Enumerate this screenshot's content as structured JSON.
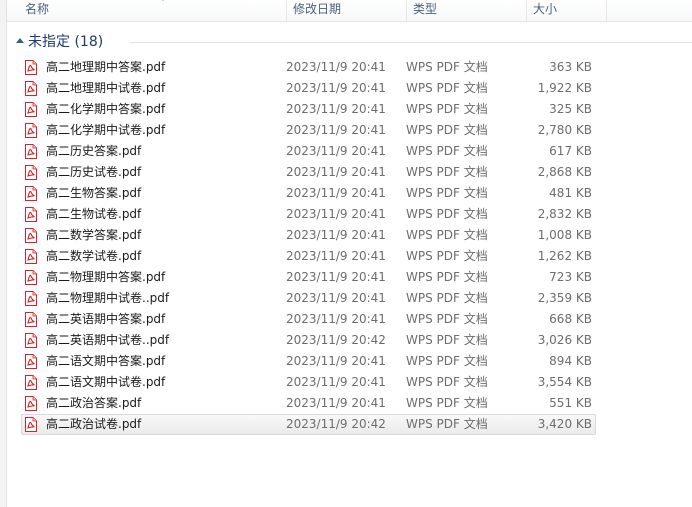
{
  "columns": {
    "name": "名称",
    "date": "修改日期",
    "type": "类型",
    "size": "大小"
  },
  "group": {
    "title": "未指定 (18)"
  },
  "colors": {
    "pdf_icon_red": "#d9232a",
    "group_title": "#1e3a6e",
    "header_text": "#4c607a"
  },
  "files": [
    {
      "name": "高二地理期中答案.pdf",
      "date": "2023/11/9 20:41",
      "type": "WPS PDF 文档",
      "size": "363 KB",
      "icon": "pdf-file-icon"
    },
    {
      "name": "高二地理期中试卷.pdf",
      "date": "2023/11/9 20:41",
      "type": "WPS PDF 文档",
      "size": "1,922 KB",
      "icon": "pdf-file-icon"
    },
    {
      "name": "高二化学期中答案.pdf",
      "date": "2023/11/9 20:41",
      "type": "WPS PDF 文档",
      "size": "325 KB",
      "icon": "pdf-file-icon"
    },
    {
      "name": "高二化学期中试卷.pdf",
      "date": "2023/11/9 20:41",
      "type": "WPS PDF 文档",
      "size": "2,780 KB",
      "icon": "pdf-file-icon"
    },
    {
      "name": "高二历史答案.pdf",
      "date": "2023/11/9 20:41",
      "type": "WPS PDF 文档",
      "size": "617 KB",
      "icon": "pdf-file-icon"
    },
    {
      "name": "高二历史试卷.pdf",
      "date": "2023/11/9 20:41",
      "type": "WPS PDF 文档",
      "size": "2,868 KB",
      "icon": "pdf-file-icon"
    },
    {
      "name": "高二生物答案.pdf",
      "date": "2023/11/9 20:41",
      "type": "WPS PDF 文档",
      "size": "481 KB",
      "icon": "pdf-file-icon"
    },
    {
      "name": "高二生物试卷.pdf",
      "date": "2023/11/9 20:41",
      "type": "WPS PDF 文档",
      "size": "2,832 KB",
      "icon": "pdf-file-icon"
    },
    {
      "name": "高二数学答案.pdf",
      "date": "2023/11/9 20:41",
      "type": "WPS PDF 文档",
      "size": "1,008 KB",
      "icon": "pdf-file-icon"
    },
    {
      "name": "高二数学试卷.pdf",
      "date": "2023/11/9 20:41",
      "type": "WPS PDF 文档",
      "size": "1,262 KB",
      "icon": "pdf-file-icon"
    },
    {
      "name": "高二物理期中答案.pdf",
      "date": "2023/11/9 20:41",
      "type": "WPS PDF 文档",
      "size": "723 KB",
      "icon": "pdf-file-icon"
    },
    {
      "name": "高二物理期中试卷..pdf",
      "date": "2023/11/9 20:41",
      "type": "WPS PDF 文档",
      "size": "2,359 KB",
      "icon": "pdf-file-icon"
    },
    {
      "name": "高二英语期中答案.pdf",
      "date": "2023/11/9 20:41",
      "type": "WPS PDF 文档",
      "size": "668 KB",
      "icon": "pdf-file-icon"
    },
    {
      "name": "高二英语期中试卷..pdf",
      "date": "2023/11/9 20:42",
      "type": "WPS PDF 文档",
      "size": "3,026 KB",
      "icon": "pdf-file-icon"
    },
    {
      "name": "高二语文期中答案.pdf",
      "date": "2023/11/9 20:41",
      "type": "WPS PDF 文档",
      "size": "894 KB",
      "icon": "pdf-file-icon"
    },
    {
      "name": "高二语文期中试卷.pdf",
      "date": "2023/11/9 20:41",
      "type": "WPS PDF 文档",
      "size": "3,554 KB",
      "icon": "pdf-file-icon"
    },
    {
      "name": "高二政治答案.pdf",
      "date": "2023/11/9 20:41",
      "type": "WPS PDF 文档",
      "size": "551 KB",
      "icon": "pdf-file-icon"
    },
    {
      "name": "高二政治试卷.pdf",
      "date": "2023/11/9 20:42",
      "type": "WPS PDF 文档",
      "size": "3,420 KB",
      "icon": "pdf-file-icon",
      "selected": true
    }
  ]
}
